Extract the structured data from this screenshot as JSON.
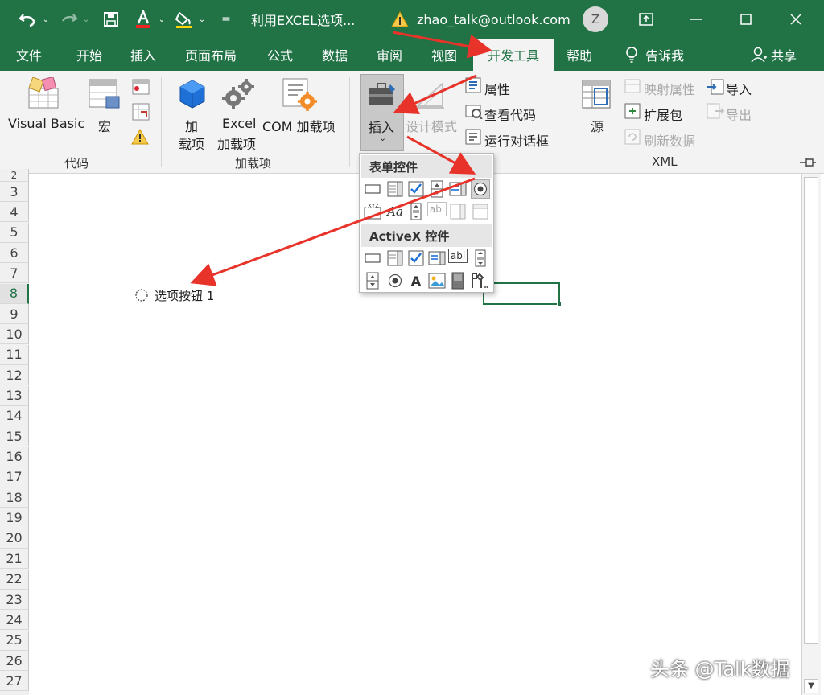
{
  "titlebar": {
    "quick_access_more": "=",
    "title": "利用EXCEL选项...",
    "account_email": "zhao_talk@outlook.com",
    "avatar_initial": "Z"
  },
  "tabs": [
    "文件",
    "开始",
    "插入",
    "页面布局",
    "公式",
    "数据",
    "审阅",
    "视图",
    "开发工具",
    "帮助",
    "告诉我",
    "共享"
  ],
  "ribbon": {
    "code": {
      "visual_basic": "Visual Basic",
      "macro": "宏",
      "label": "代码"
    },
    "addins": {
      "addin_l1": "加",
      "addin_l2": "载项",
      "excel_l1": "Excel",
      "excel_l2": "加载项",
      "com": "COM 加载项",
      "label": "加载项"
    },
    "controls": {
      "insert": "插入",
      "design_mode": "设计模式",
      "properties": "属性",
      "view_code": "查看代码",
      "run_dialog": "运行对话框"
    },
    "xml": {
      "source": "源",
      "map_properties": "映射属性",
      "expansion_packs": "扩展包",
      "refresh_data": "刷新数据",
      "import": "导入",
      "export": "导出",
      "label": "XML"
    }
  },
  "dropdown": {
    "form_header": "表单控件",
    "activex_header": "ActiveX 控件",
    "xyz": "XYZ",
    "aa": "Aa",
    "abl": "abl",
    "A": "A"
  },
  "sheet": {
    "row_numbers": [
      "2",
      "3",
      "4",
      "5",
      "6",
      "7",
      "8",
      "9",
      "10",
      "11",
      "12",
      "13",
      "14",
      "15",
      "16",
      "17",
      "18",
      "19",
      "20",
      "21",
      "22",
      "23",
      "24",
      "25",
      "26",
      "27"
    ],
    "option_button_label": "选项按钮 1"
  },
  "watermark": "头条 @Talk数据",
  "colors": {
    "excel_green": "#217346",
    "arrow_red": "#e8332a",
    "ribbon_bg": "#f3f3f3"
  }
}
